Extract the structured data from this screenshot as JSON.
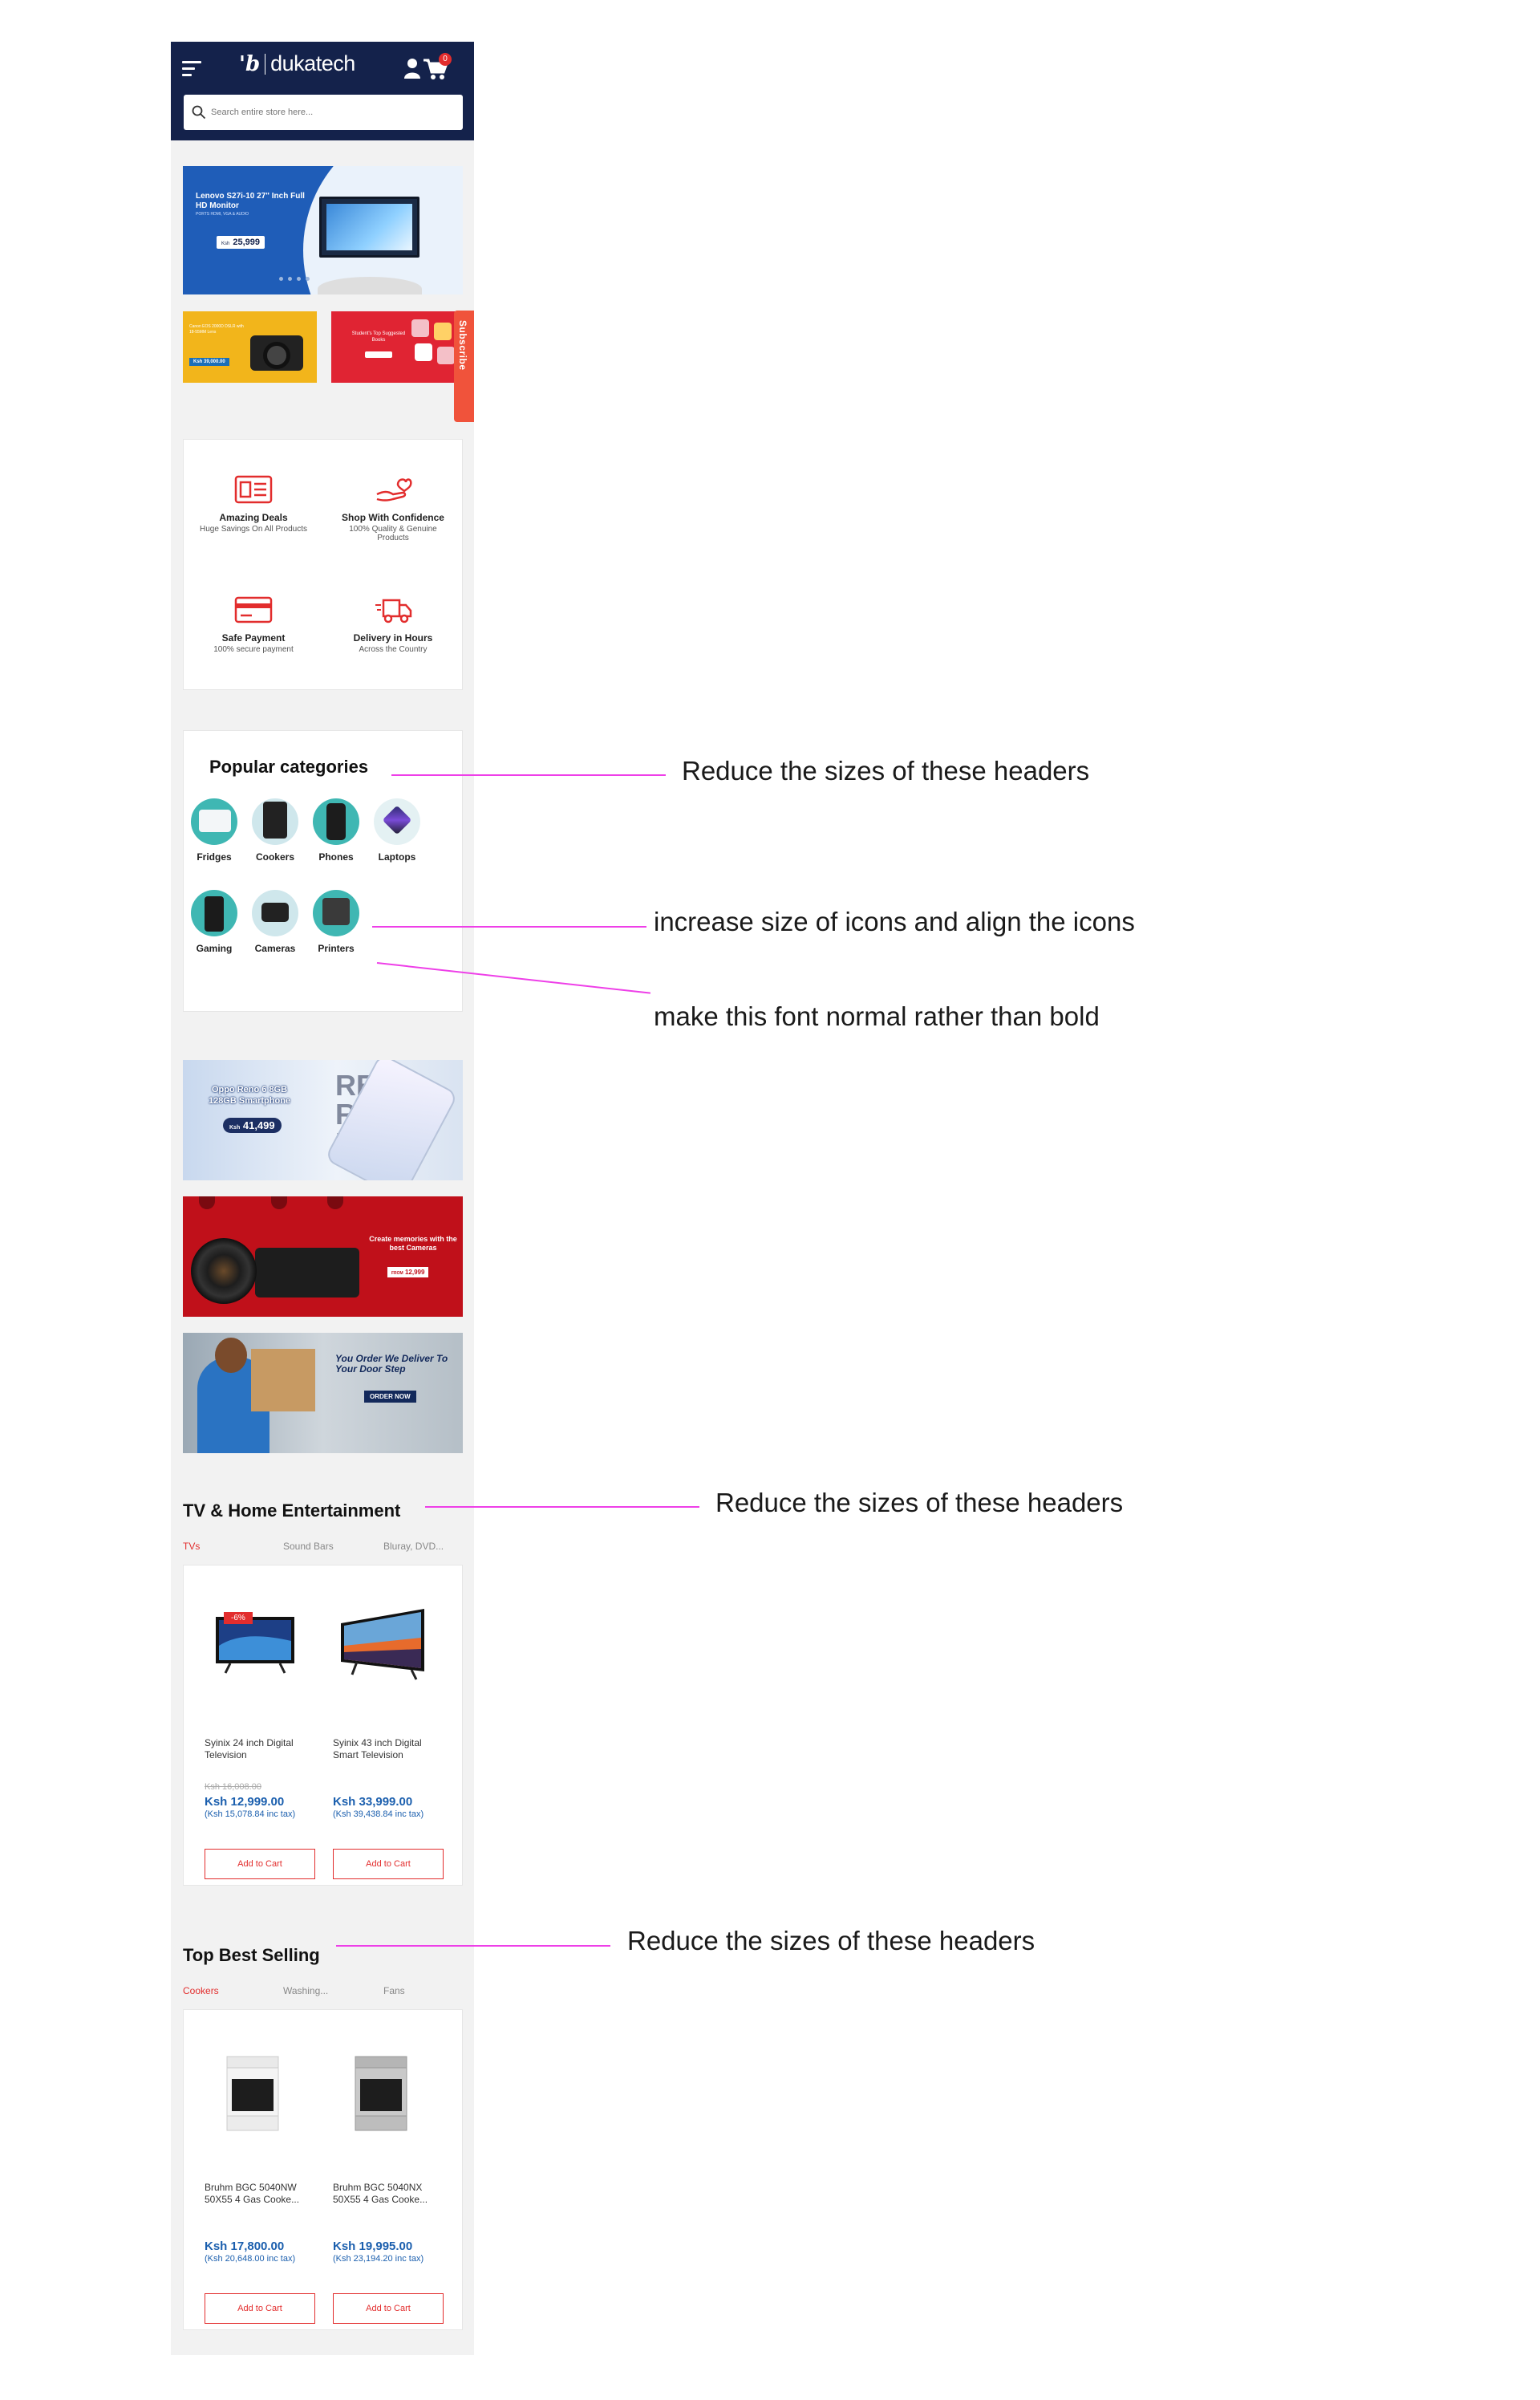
{
  "header": {
    "logo_mark": "'b",
    "logo_text": "dukatech",
    "cart_count": "0",
    "search_placeholder": "Search entire store here..."
  },
  "hero": {
    "title": "Lenovo S27i-10 27\" Inch Full HD Monitor",
    "subtitle": "PORTS HDMI, VGA & AUDIO",
    "price_prefix": "Ksh",
    "price": "25,999"
  },
  "promos": {
    "camera_text": "Canon EOS 2000D DSLR with 18-55MM Lens",
    "camera_price": "Ksh 39,000.00",
    "books_text": "Student's Top Suggested Books"
  },
  "subscribe_label": "Subscribe",
  "features": [
    {
      "title": "Amazing Deals",
      "desc": "Huge Savings On All Products",
      "icon": "deal-tag-icon"
    },
    {
      "title": "Shop With Confidence",
      "desc": "100% Quality & Genuine Products",
      "icon": "hand-heart-icon"
    },
    {
      "title": "Safe Payment",
      "desc": "100% secure payment",
      "icon": "credit-card-icon"
    },
    {
      "title": "Delivery in Hours",
      "desc": "Across the Country",
      "icon": "delivery-truck-icon"
    }
  ],
  "categories": {
    "title": "Popular categories",
    "items": [
      "Fridges",
      "Cookers",
      "Phones",
      "Laptops",
      "Gaming",
      "Cameras",
      "Printers"
    ]
  },
  "banners": {
    "oppo_title": "Oppo Reno 6 8GB 128GB Smartphone",
    "oppo_price_prefix": "Ksh",
    "oppo_price": "41,499",
    "oppo_words": "RE\nRE\nRE",
    "cameras_text": "Create memories with the best Cameras",
    "cameras_price_prefix": "FROM",
    "cameras_price": "12,999",
    "delivery_text": "You Order We Deliver To Your Door Step",
    "delivery_button": "ORDER NOW"
  },
  "tv_section": {
    "title": "TV & Home Entertainment",
    "tabs": [
      "TVs",
      "Sound Bars",
      "Bluray, DVD..."
    ],
    "products": [
      {
        "name": "Syinix 24 inch Digital Television",
        "old_price": "Ksh 16,008.00",
        "price": "Ksh 12,999.00",
        "tax": "(Ksh 15,078.84 inc tax)",
        "discount": "-6%",
        "button": "Add to Cart"
      },
      {
        "name": "Syinix 43 inch Digital Smart Television",
        "old_price": "",
        "price": "Ksh 33,999.00",
        "tax": "(Ksh 39,438.84 inc tax)",
        "discount": "",
        "button": "Add to Cart"
      }
    ]
  },
  "best_section": {
    "title": "Top Best Selling",
    "tabs": [
      "Cookers",
      "Washing...",
      "Fans"
    ],
    "products": [
      {
        "name": "Bruhm BGC 5040NW 50X55 4 Gas Cooke...",
        "price": "Ksh 17,800.00",
        "tax": "(Ksh 20,648.00 inc tax)",
        "button": "Add to Cart"
      },
      {
        "name": "Bruhm BGC 5040NX 50X55 4 Gas Cooke...",
        "price": "Ksh 19,995.00",
        "tax": "(Ksh 23,194.20 inc tax)",
        "button": "Add to Cart"
      }
    ]
  },
  "annotations": [
    "Reduce the sizes of these headers",
    "increase size of icons and align the icons",
    "make this font normal rather than bold",
    "Reduce the sizes of these headers",
    "Reduce the sizes of these headers"
  ],
  "colors": {
    "header_bg": "#14224b",
    "accent_red": "#e22d2d",
    "price_blue": "#1b5fae",
    "annotation_magenta": "#ee3fe8"
  }
}
